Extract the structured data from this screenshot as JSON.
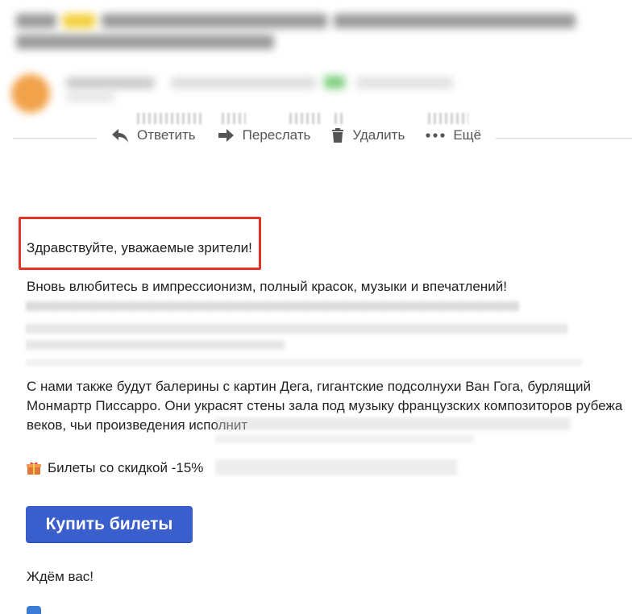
{
  "toolbar": {
    "reply": "Ответить",
    "forward": "Переслать",
    "delete": "Удалить",
    "more": "Ещё"
  },
  "body": {
    "greeting": "Здравствуйте, уважаемые зрители!",
    "intro": "Вновь влюбитесь в импрессионизм, полный красок, музыки и впечатлений!",
    "paragraph": "С нами также будут балерины с картин Дега, гигантские подсолнухи Ван Гога, бурлящий Монмартр Писсарро. Они украсят стены зала под музыку французских композиторов рубежа веков, чьи произведения исполнит",
    "tickets": "Билеты со скидкой -15%",
    "buy_button": "Купить билеты",
    "closing": "Ждём вас!"
  },
  "colors": {
    "accent": "#3a5fcd",
    "highlight_border": "#e3342a"
  },
  "icons": {
    "reply": "reply-arrow-icon",
    "forward": "forward-arrow-icon",
    "delete": "trash-icon",
    "more": "more-dots-icon",
    "tickets": "gift-icon"
  }
}
